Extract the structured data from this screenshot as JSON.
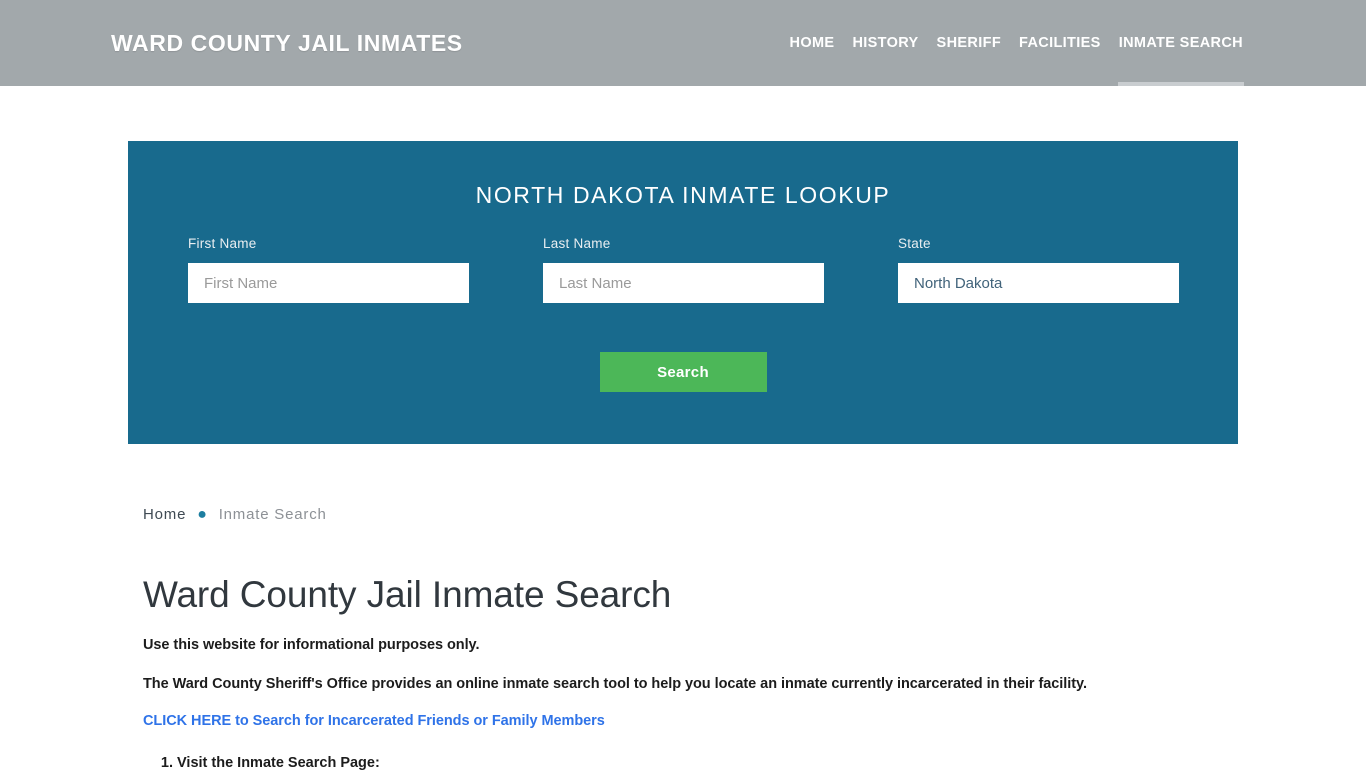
{
  "header": {
    "brand": "WARD COUNTY JAIL INMATES",
    "nav": [
      {
        "label": "HOME",
        "active": false
      },
      {
        "label": "HISTORY",
        "active": false
      },
      {
        "label": "SHERIFF",
        "active": false
      },
      {
        "label": "FACILITIES",
        "active": false
      },
      {
        "label": "INMATE SEARCH",
        "active": true
      }
    ],
    "background_color": "#a2a8ab"
  },
  "lookup": {
    "title": "NORTH DAKOTA INMATE LOOKUP",
    "panel_color": "#186a8d",
    "fields": [
      {
        "label": "First Name",
        "placeholder": "First Name",
        "value": ""
      },
      {
        "label": "Last Name",
        "placeholder": "Last Name",
        "value": ""
      },
      {
        "label": "State",
        "placeholder": "",
        "value": "North Dakota"
      }
    ],
    "search_button": "Search",
    "search_button_color": "#4cb758"
  },
  "breadcrumb": {
    "home": "Home",
    "separator": "●",
    "current": "Inmate Search"
  },
  "content": {
    "title": "Ward County Jail Inmate Search",
    "paragraph_1": "Use this website for informational purposes only.",
    "paragraph_2": "The Ward County Sheriff's Office provides an online inmate search tool to help you locate an inmate currently incarcerated in their facility.",
    "cta_link": "CLICK HERE to Search for Incarcerated Friends or Family Members",
    "steps": [
      "Visit the Inmate Search Page:"
    ]
  }
}
